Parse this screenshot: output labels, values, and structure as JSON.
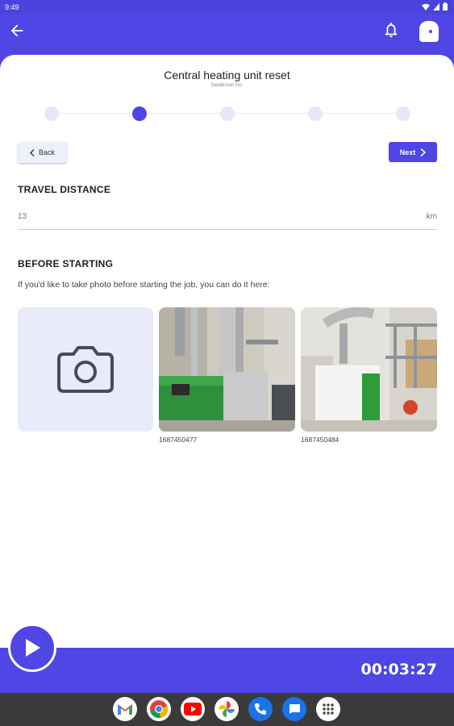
{
  "status_bar": {
    "time": "9:49"
  },
  "header": {
    "title": "Central heating unit reset",
    "subtitle": "Stedenson Inc."
  },
  "stepper": {
    "steps": 5,
    "active_index": 1
  },
  "nav": {
    "back_label": "Back",
    "next_label": "Next"
  },
  "travel": {
    "heading": "TRAVEL DISTANCE",
    "value": "13",
    "unit": "km"
  },
  "before_starting": {
    "heading": "BEFORE STARTING",
    "description": "If you'd like to take photo before starting the job, you can do it here:",
    "photos": [
      {
        "label": "1687450477"
      },
      {
        "label": "1687450484"
      }
    ]
  },
  "timer": {
    "value": "00:03:27"
  },
  "colors": {
    "primary": "#4f46e5",
    "step_inactive": "#e6e8f8",
    "photo_placeholder": "#e9ebfa"
  },
  "dock": [
    "gmail-icon",
    "chrome-icon",
    "youtube-icon",
    "photos-icon",
    "phone-icon",
    "messages-icon",
    "apps-icon"
  ]
}
